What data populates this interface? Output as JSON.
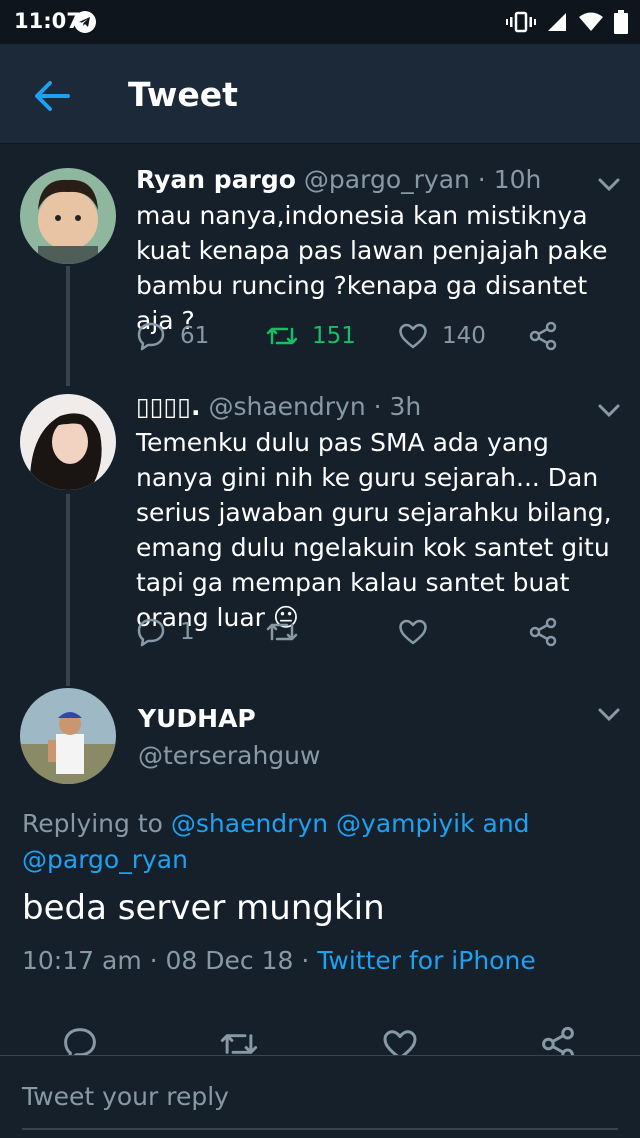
{
  "status_bar": {
    "time": "11:07"
  },
  "appbar": {
    "title": "Tweet"
  },
  "tweets": [
    {
      "name": "Ryan pargo",
      "handle": "@pargo_ryan",
      "time": " · 10h",
      "text": "mau nanya,indonesia kan mistiknya kuat kenapa pas lawan penjajah pake bambu runcing ?kenapa ga disantet aja ?",
      "reply_count": "61",
      "retweet_count": "151",
      "like_count": "140"
    },
    {
      "name": "▯▯▯▯.",
      "handle": "@shaendryn",
      "time": " · 3h",
      "text": "Temenku dulu pas SMA ada yang nanya gini nih ke guru sejarah... Dan serius jawaban guru sejarahku bilang, emang dulu ngelakuin kok santet gitu tapi ga mempan kalau santet buat orang luar 😐",
      "reply_count": "1",
      "retweet_count": "",
      "like_count": ""
    }
  ],
  "main_tweet": {
    "name": "YUDHAP",
    "handle": "@terserahguw",
    "replying_prefix": "Replying to ",
    "mention1": "@shaendryn",
    "mention2": "@yampiyik",
    "and_word": " and",
    "mention3": "@pargo_ryan",
    "text": "beda server mungkin",
    "timestamp": "10:17 am · 08 Dec 18 · ",
    "client": "Twitter for iPhone"
  },
  "reply_bar": {
    "placeholder": "Tweet your reply"
  },
  "colors": {
    "background": "#15202b",
    "header": "#1c2938",
    "accent": "#1da1f2",
    "retweet_active": "#17bf63",
    "secondary_text": "#8899a6"
  },
  "icons": [
    "telegram-icon",
    "vibrate-icon",
    "signal-icon",
    "wifi-icon",
    "battery-icon",
    "back-arrow-icon",
    "chevron-down-icon",
    "reply-icon",
    "retweet-icon",
    "like-icon",
    "share-icon"
  ]
}
